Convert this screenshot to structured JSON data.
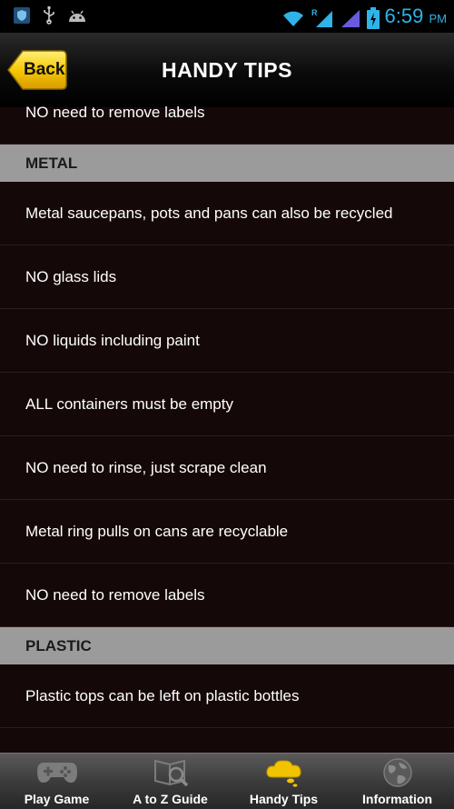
{
  "status_bar": {
    "time": "6:59",
    "ampm": "PM"
  },
  "header": {
    "title": "HANDY TIPS",
    "back_label": "Back"
  },
  "list": {
    "partial_item": "NO need to remove labels",
    "sections": [
      {
        "title": "METAL",
        "items": [
          "Metal saucepans, pots and pans can also be recycled",
          "NO glass lids",
          "NO liquids including paint",
          "ALL containers must be empty",
          "NO need to rinse, just scrape clean",
          "Metal ring pulls on cans are recyclable",
          "NO need to remove labels"
        ]
      },
      {
        "title": "PLASTIC",
        "items": [
          "Plastic tops can be left on plastic bottles"
        ]
      }
    ]
  },
  "tabs": [
    {
      "label": "Play Game",
      "icon": "gamepad-icon",
      "active": false
    },
    {
      "label": "A to Z Guide",
      "icon": "book-search-icon",
      "active": false
    },
    {
      "label": "Handy Tips",
      "icon": "lightbulb-cloud-icon",
      "active": true
    },
    {
      "label": "Information",
      "icon": "globe-icon",
      "active": false
    }
  ]
}
